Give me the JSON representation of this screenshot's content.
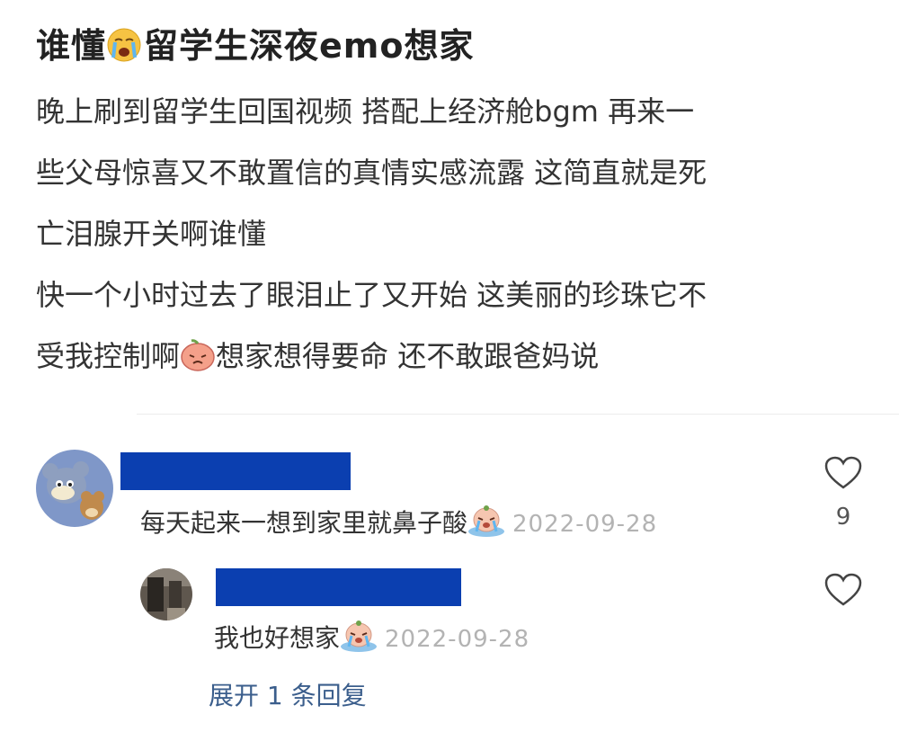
{
  "post": {
    "title_prefix": "谁懂",
    "title_emoji": "loudly-crying-emoji",
    "title_suffix": "留学生深夜emo想家",
    "body_lines": [
      "晚上刷到留学生回国视频 搭配上经济舱bgm 再来一",
      "些父母惊喜又不敢置信的真情实感流露 这简直就是死",
      "亡泪腺开关啊谁懂",
      "快一个小时过去了眼泪止了又开始 这美丽的珍珠它不"
    ],
    "last_line_before": "受我控制啊",
    "last_line_emoji": "sad-peach-emoji",
    "last_line_after": "想家想得要命 还不敢跟爸妈说"
  },
  "comments": [
    {
      "avatar": "cartoon-cat-mouse-avatar",
      "text": "每天起来一想到家里就鼻子酸",
      "emoji": "crying-baby-emoji",
      "date": "2022-09-28",
      "likes": "9"
    }
  ],
  "reply": {
    "avatar": "dark-photo-avatar",
    "text": "我也好想家",
    "emoji": "crying-baby-emoji",
    "date": "2022-09-28"
  },
  "expand_label": "展开 1 条回复",
  "colors": {
    "redaction": "#0b3fb0",
    "link": "#3b5e8c",
    "date": "#b3b3b3"
  }
}
